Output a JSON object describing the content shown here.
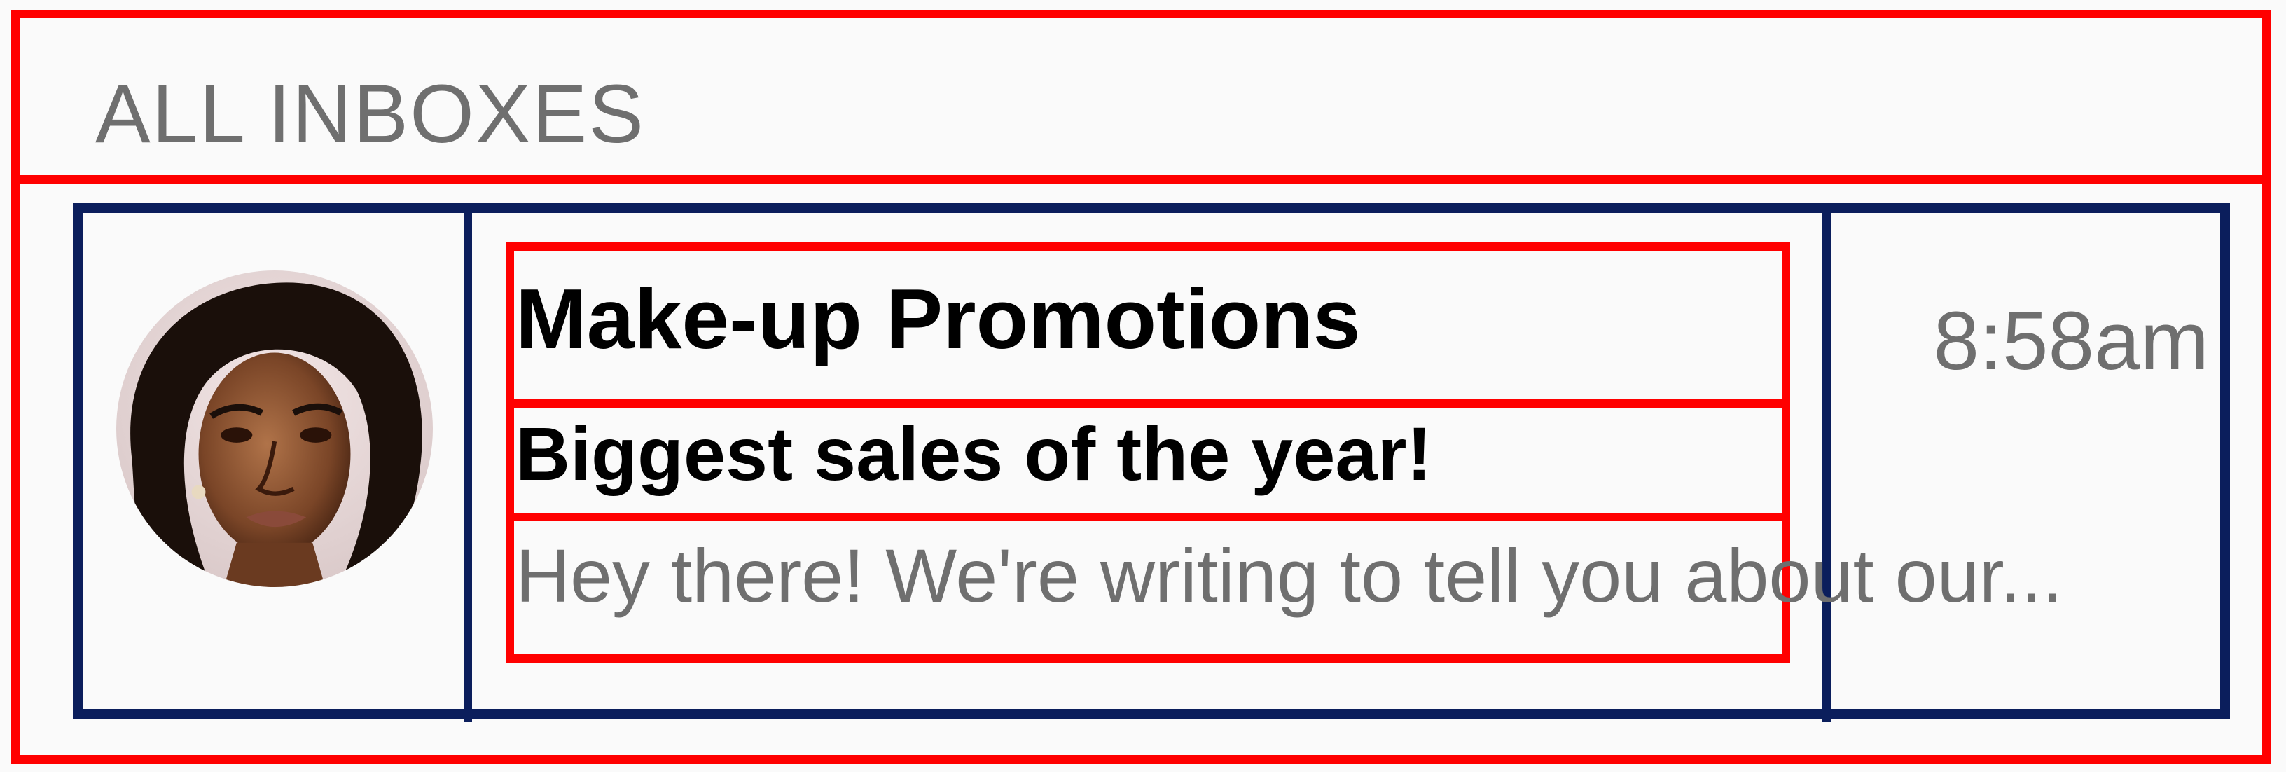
{
  "section": {
    "title": "ALL INBOXES"
  },
  "email": {
    "sender": "Make-up Promotions",
    "subject": "Biggest sales of the year!",
    "preview": "Hey there! We're writing to tell you about our...",
    "time": "8:58am",
    "avatar_icon": "avatar-photo"
  },
  "colors": {
    "annotation_red": "#ff0000",
    "annotation_navy": "#0b1e5c",
    "muted_text": "#6f6f6f",
    "background": "#fafafa"
  }
}
